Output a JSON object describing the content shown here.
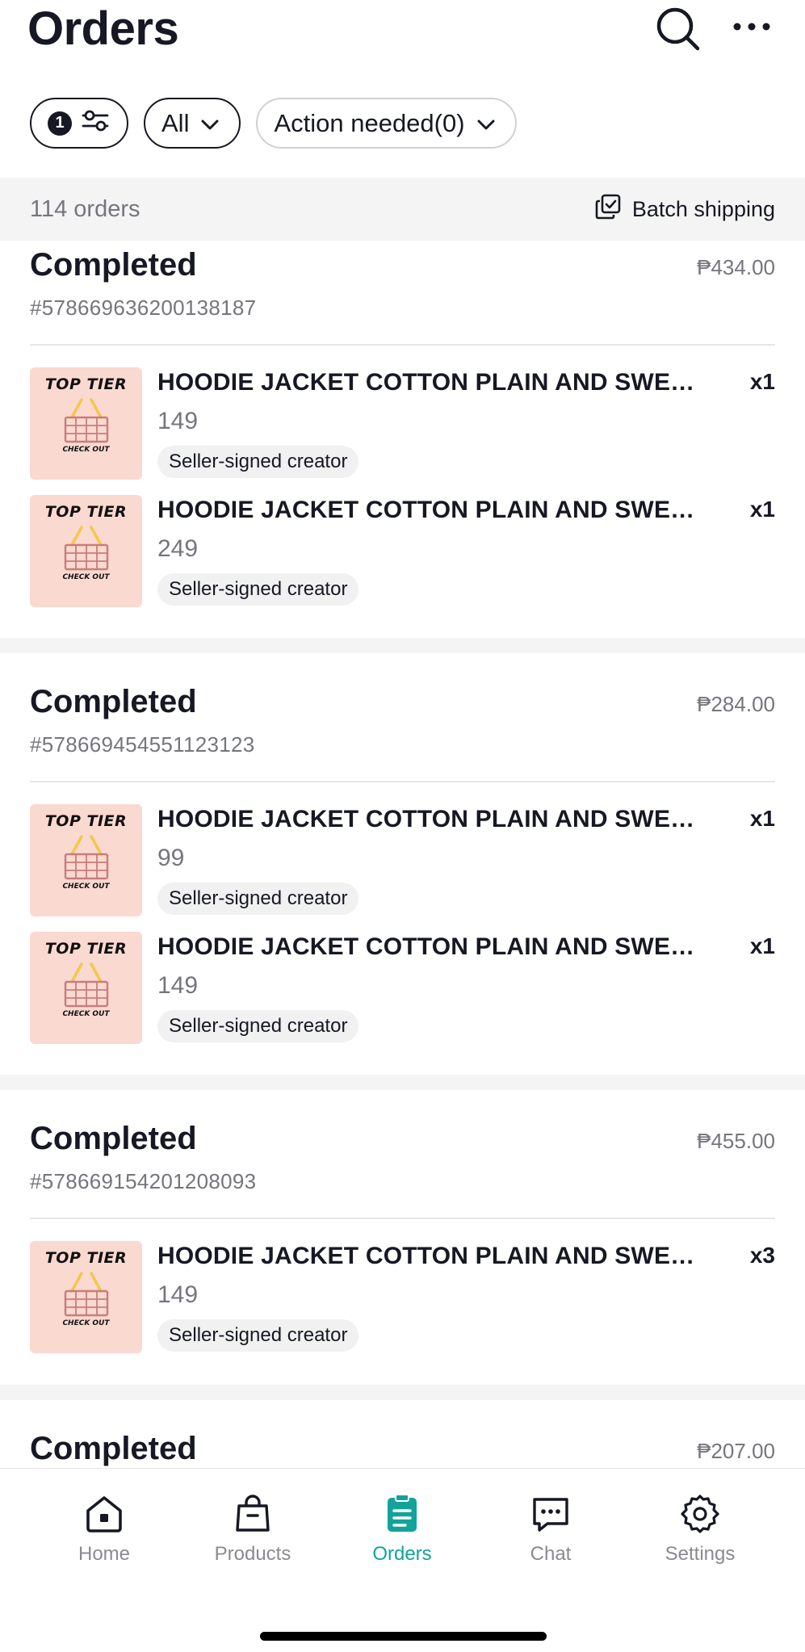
{
  "header": {
    "title": "Orders",
    "search_icon": "search-icon",
    "more_icon": "more-icon"
  },
  "filters": {
    "filter_count": "1",
    "status_label": "All",
    "action_label": "Action needed(0)"
  },
  "summary": {
    "count_label": "114 orders",
    "batch_label": "Batch shipping"
  },
  "orders": [
    {
      "status": "Completed",
      "total": "₱434.00",
      "id": "#578669636200138187",
      "items": [
        {
          "name": "HOODIE JACKET COTTON PLAIN AND SWEAT ...",
          "price": "149",
          "qty": "x1",
          "tag": "Seller-signed creator",
          "thumb_top": "TOP TIER",
          "thumb_bottom": "CHECK OUT"
        },
        {
          "name": "HOODIE JACKET COTTON PLAIN AND SWEAT ...",
          "price": "249",
          "qty": "x1",
          "tag": "Seller-signed creator",
          "thumb_top": "TOP TIER",
          "thumb_bottom": "CHECK OUT"
        }
      ]
    },
    {
      "status": "Completed",
      "total": "₱284.00",
      "id": "#578669454551123123",
      "items": [
        {
          "name": "HOODIE JACKET COTTON PLAIN AND SWEAT ...",
          "price": "99",
          "qty": "x1",
          "tag": "Seller-signed creator",
          "thumb_top": "TOP TIER",
          "thumb_bottom": "CHECK OUT"
        },
        {
          "name": "HOODIE JACKET COTTON PLAIN AND SWEAT ...",
          "price": "149",
          "qty": "x1",
          "tag": "Seller-signed creator",
          "thumb_top": "TOP TIER",
          "thumb_bottom": "CHECK OUT"
        }
      ]
    },
    {
      "status": "Completed",
      "total": "₱455.00",
      "id": "#578669154201208093",
      "items": [
        {
          "name": "HOODIE JACKET COTTON PLAIN AND SWEAT ...",
          "price": "149",
          "qty": "x3",
          "tag": "Seller-signed creator",
          "thumb_top": "TOP TIER",
          "thumb_bottom": "CHECK OUT"
        }
      ]
    },
    {
      "status": "Completed",
      "total": "₱207.00"
    }
  ],
  "tabbar": {
    "tabs": [
      {
        "label": "Home",
        "icon": "home-icon"
      },
      {
        "label": "Products",
        "icon": "bag-icon"
      },
      {
        "label": "Orders",
        "icon": "orders-icon",
        "active": true
      },
      {
        "label": "Chat",
        "icon": "chat-icon"
      },
      {
        "label": "Settings",
        "icon": "gear-icon"
      }
    ]
  },
  "colors": {
    "accent": "#12a39a",
    "thumb_bg": "#fad9d0",
    "muted_text": "#75767c",
    "section_bg": "#f4f4f5"
  }
}
